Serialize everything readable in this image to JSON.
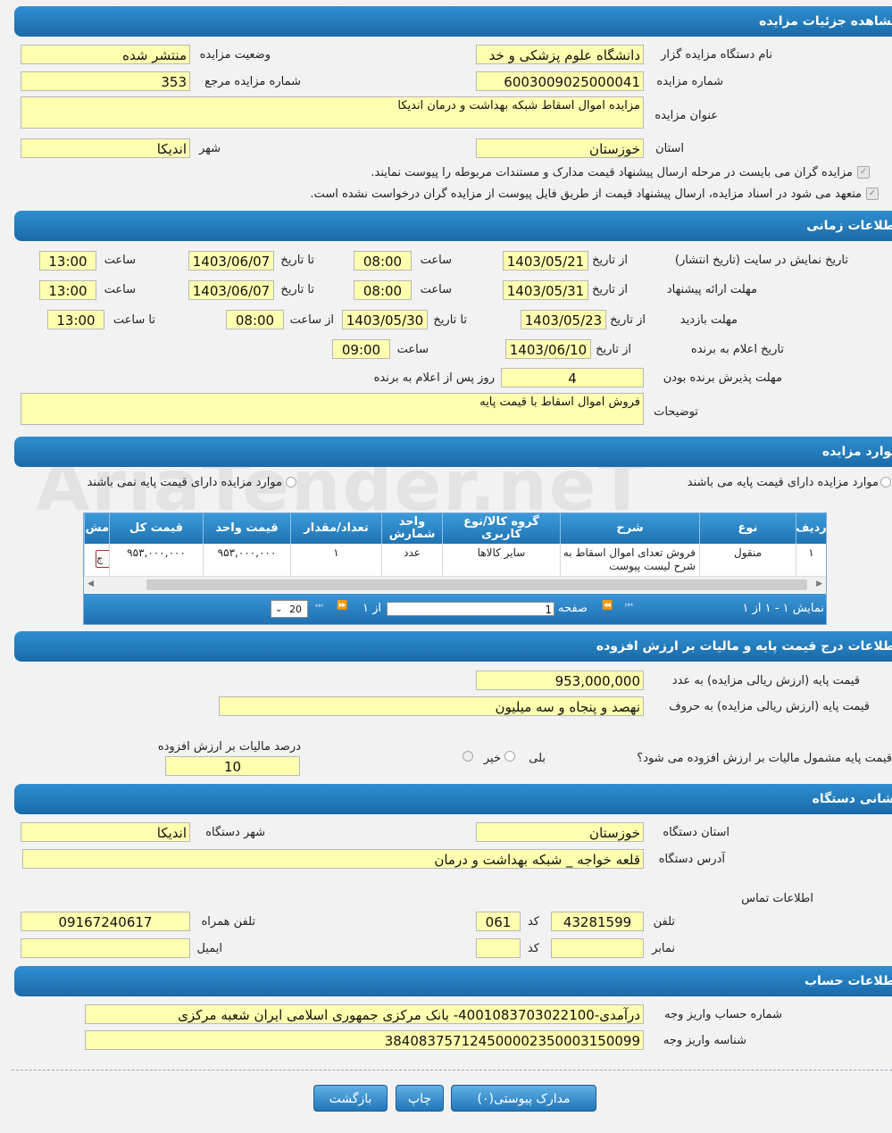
{
  "sections": {
    "details": "مشاهده جزئیات مزایده",
    "time": "اطلاعات زمانی",
    "items": "موارد مزایده",
    "price": "اطلاعات درج قیمت پایه و مالیات بر ارزش افزوده",
    "address": "نشانی دستگاه",
    "account": "اطلاعات حساب"
  },
  "details": {
    "org_label": "نام دستگاه مزایده گزار",
    "org_value": "دانشگاه علوم پزشکی و خد",
    "status_label": "وضعیت مزایده",
    "status_value": "منتشر شده",
    "number_label": "شماره مزایده",
    "number_value": "6003009025000041",
    "ref_label": "شماره مزایده مرجع",
    "ref_value": "353",
    "title_label": "عنوان مزایده",
    "title_value": "مزایده اموال اسقاط شبکه بهداشت و درمان اندیکا",
    "province_label": "استان",
    "province_value": "خوزستان",
    "city_label": "شهر",
    "city_value": "اندیکا",
    "check1": "مزایده گران می بایست در مرحله ارسال پیشنهاد قیمت مدارک و مستندات مربوطه را پیوست نمایند.",
    "check2": "متعهد می شود در اسناد مزایده، ارسال پیشنهاد قیمت از طریق فایل پیوست از مزایده گران درخواست نشده است."
  },
  "time": {
    "site_label": "تاریخ نمایش در سایت (تاریخ انتشار)",
    "offer_label": "مهلت ارائه پیشنهاد",
    "visit_label": "مهلت بازدید",
    "announce_label": "تاریخ اعلام به برنده",
    "accept_label": "مهلت پذیرش برنده بودن",
    "from_date": "از تاریخ",
    "to_date": "تا تاریخ",
    "time": "ساعت",
    "from_time": "از ساعت",
    "to_time": "تا ساعت",
    "site_from": "1403/05/21",
    "site_from_time": "08:00",
    "site_to": "1403/06/07",
    "site_to_time": "13:00",
    "offer_from": "1403/05/31",
    "offer_from_time": "08:00",
    "offer_to": "1403/06/07",
    "offer_to_time": "13:00",
    "visit_from": "1403/05/23",
    "visit_to": "1403/05/30",
    "visit_from_time": "08:00",
    "visit_to_time": "13:00",
    "announce_from": "1403/06/10",
    "announce_time": "09:00",
    "accept_days": "4",
    "accept_suffix": "روز پس از اعلام به برنده",
    "desc_label": "توضیحات",
    "desc_value": "فروش اموال اسقاط با قیمت پایه"
  },
  "items": {
    "radio1": "موارد مزایده دارای قیمت پایه می باشند",
    "radio2": "موارد مزایده دارای قیمت پایه نمی باشند",
    "columns": [
      "ردیف",
      "نوع",
      "شرح",
      "گروه کالا/نوع کاربری",
      "واحد شمارش",
      "تعداد/مقدار",
      "قیمت واحد",
      "قیمت کل",
      "مش"
    ],
    "row": [
      "۱",
      "منقول",
      "فروش تعدای اموال اسقاط به شرح لیست پیوست",
      "سایر کالاها",
      "عدد",
      "۱",
      "۹۵۳,۰۰۰,۰۰۰",
      "۹۵۳,۰۰۰,۰۰۰",
      "ج"
    ],
    "pager_show": "نمایش ۱ - ۱ از ۱",
    "pager_page": "صفحه",
    "pager_page_value": "1",
    "pager_of": "از ۱",
    "pager_size": "20"
  },
  "price": {
    "base_num_label": "قیمت پایه (ارزش ریالی مزایده) به عدد",
    "base_num_value": "953,000,000",
    "base_word_label": "قیمت پایه (ارزش ریالی مزایده) به حروف",
    "base_word_value": "نهصد و پنجاه و سه میلیون",
    "vat_q": "قیمت پایه مشمول مالیات بر ارزش افزوده می شود؟",
    "yes": "بلی",
    "no": "خیر",
    "vat_pct_label": "درصد مالیات بر ارزش افزوده",
    "vat_pct_value": "10"
  },
  "address": {
    "province_label": "استان دستگاه",
    "province_value": "خوزستان",
    "city_label": "شهر دستگاه",
    "city_value": "اندیکا",
    "addr_label": "آدرس دستگاه",
    "addr_value": "قلعه خواجه _ شبکه بهداشت و درمان",
    "contact": "اطلاعات تماس",
    "phone_label": "تلفن",
    "phone_value": "43281599",
    "code_label": "کد",
    "code_value": "061",
    "mobile_label": "تلفن همراه",
    "mobile_value": "09167240617",
    "fax_label": "نمابر",
    "email_label": "ایمیل"
  },
  "account": {
    "acc_label": "شماره حساب واریز وجه",
    "acc_value": "درآمدی-4001083703022100- بانک مرکزی جمهوری اسلامی ایران شعبه مرکزی",
    "id_label": "شناسه واریز وجه",
    "id_value": "384083757124500002350003150099"
  },
  "buttons": {
    "docs": "مدارک پیوستی(۰)",
    "print": "چاپ",
    "back": "بازگشت"
  },
  "watermark": "AriaTender.neT"
}
